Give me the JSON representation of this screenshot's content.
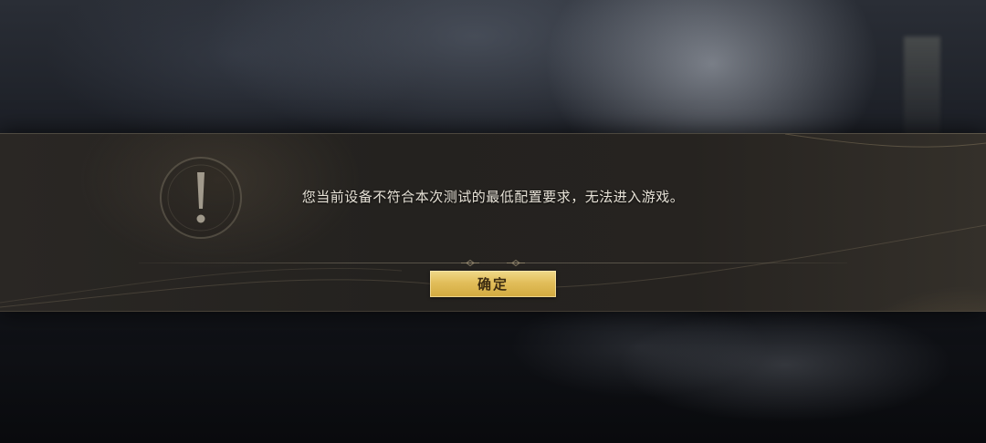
{
  "dialog": {
    "icon": "exclamation-warning-icon",
    "message": "您当前设备不符合本次测试的最低配置要求，无法进入游戏。",
    "confirm_label": "确定"
  },
  "colors": {
    "button_gold": "#e2be5a",
    "button_text": "#3a2a10",
    "message_text": "#e8e3d8",
    "panel_bg": "#262320"
  }
}
